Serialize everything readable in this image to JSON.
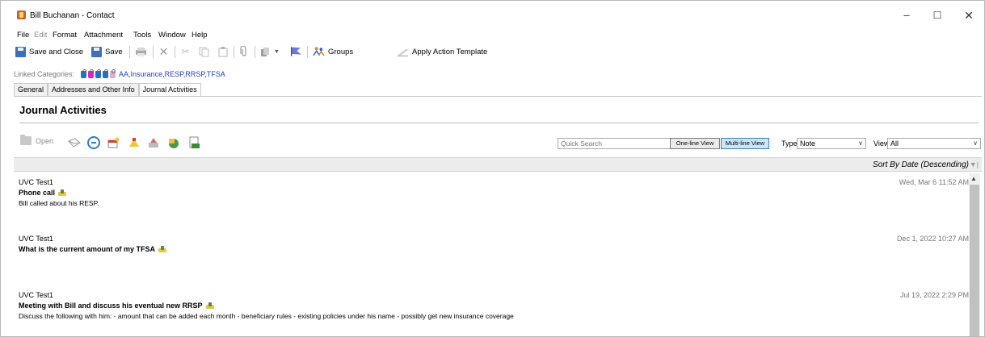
{
  "window": {
    "title": "Bill Buchanan - Contact",
    "controls": {
      "minimize": "–",
      "maximize": "☐",
      "close": "✕"
    }
  },
  "menu": [
    "File",
    "Edit",
    "Format",
    "Attachment",
    "Tools",
    "Window",
    "Help"
  ],
  "toolbar": {
    "save_close": "Save and Close",
    "save": "Save",
    "groups": "Groups",
    "apply_template": "Apply Action Template"
  },
  "linked_categories": {
    "label": "Linked Categories:",
    "text": "AA,Insurance,RESP,RRSP,TFSA",
    "tag_colors": [
      "#1a73c8",
      "#e020c8",
      "#1a73c8",
      "#1a73c8",
      "#e0b0d8"
    ]
  },
  "tabs": [
    "General",
    "Addresses and Other Info",
    "Journal Activities"
  ],
  "active_tab": 2,
  "section": {
    "title": "Journal Activities"
  },
  "activity_toolbar": {
    "open_label": "Open",
    "search_placeholder": "Quick Search",
    "view_one_line": "One-line View",
    "view_multi_line": "Multi-line View",
    "type_label": "Type:",
    "type_value": "Note",
    "view_label": "View:",
    "view_value": "All"
  },
  "sort": {
    "label": "Sort By Date (Descending)"
  },
  "entries": [
    {
      "user": "UVC Test1",
      "subject": "Phone call",
      "body": "Bill called about his RESP.",
      "date": "Wed, Mar 6 11:52 AM"
    },
    {
      "user": "UVC Test1",
      "subject": "What is the current amount of my TFSA",
      "body": "",
      "date": "Dec 1, 2022 10:27 AM"
    },
    {
      "user": "UVC Test1",
      "subject": "Meeting with Bill and discuss his eventual new RRSP",
      "body": "Discuss the following with him: - amount that can be added each month - beneficiary rules  - existing policies under his name - possibly get new insurance coverage",
      "date": "Jul 19, 2022 2:29 PM"
    }
  ]
}
